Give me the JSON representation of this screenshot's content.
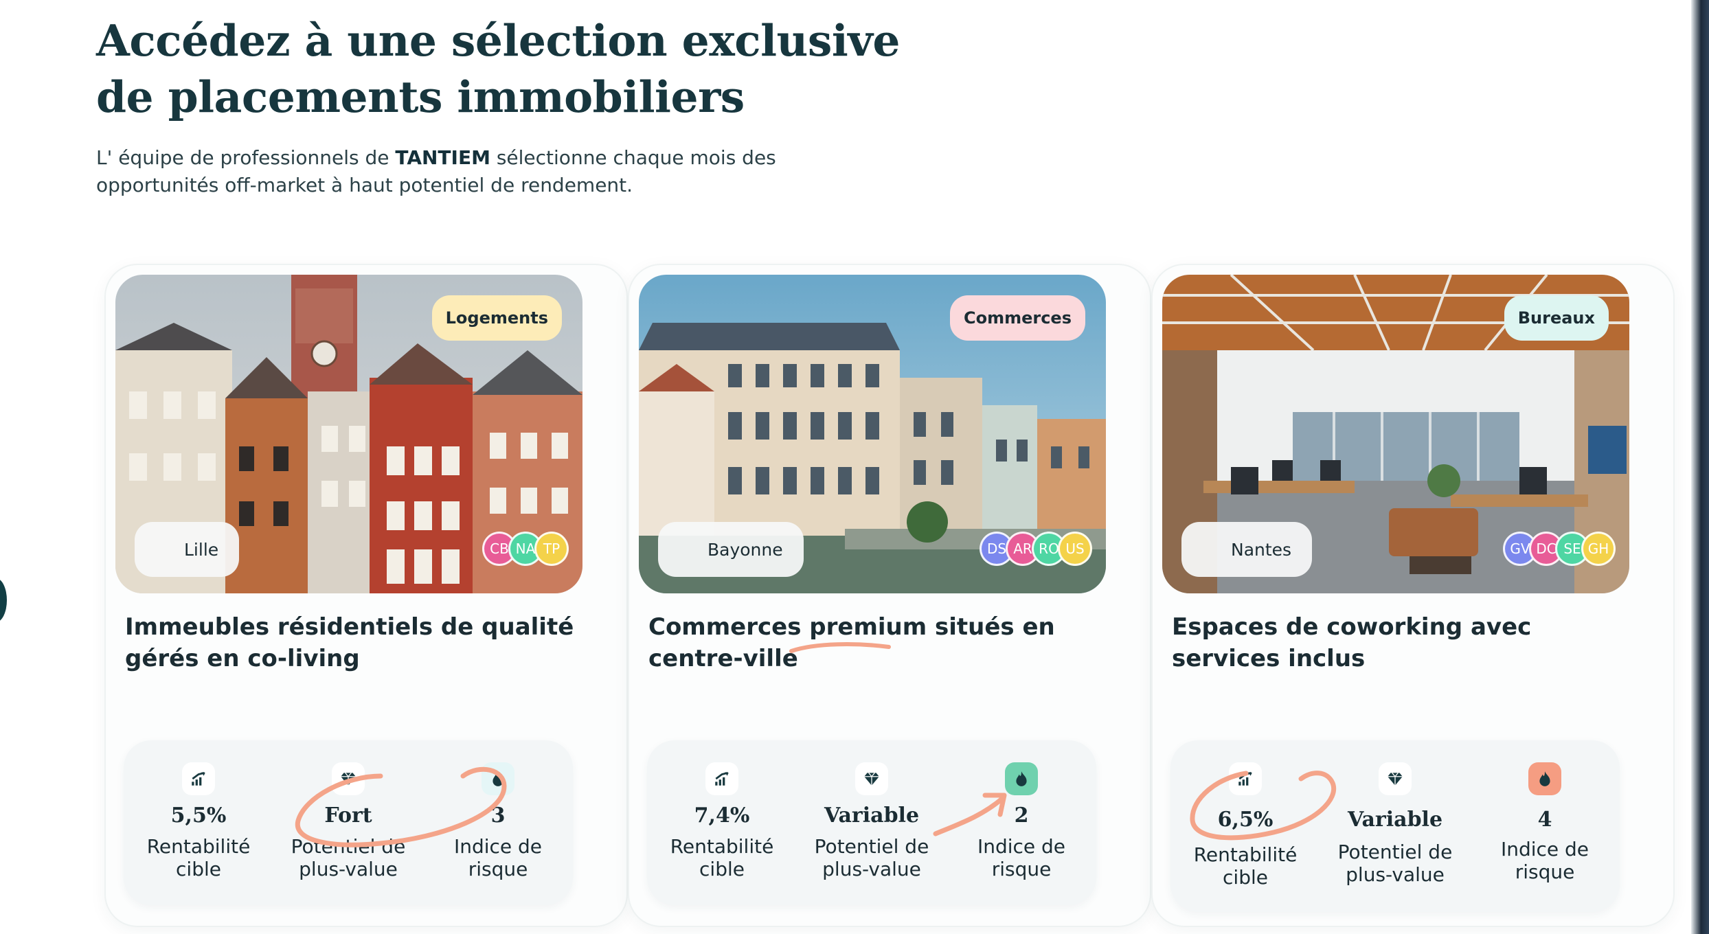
{
  "hero": {
    "title_line1": "Accédez à une sélection exclusive",
    "title_line2": "de placements immobiliers",
    "intro_before": "L' équipe de professionnels de ",
    "intro_brand": "TANTIEM",
    "intro_after": " sélectionne chaque mois des",
    "intro_line2": "opportunités off-market à haut potentiel de rendement."
  },
  "cards": [
    {
      "tag": "Logements",
      "tag_color": "#fdecb8",
      "location": "Lille",
      "avatars": [
        "CB",
        "NA",
        "TP"
      ],
      "avatar_colors": [
        "#e85c97",
        "#4ed6a3",
        "#f4d24a"
      ],
      "title": "Immeubles résidentiels de qualité gérés en co-living",
      "stats": [
        {
          "icon": "trend-up-icon",
          "value": "5,5%",
          "label_line1": "Rentabilité",
          "label_line2": "cible"
        },
        {
          "icon": "diamond-icon",
          "value": "Fort",
          "label_line1": "Potentiel de",
          "label_line2": "plus-value"
        },
        {
          "icon": "flame-icon",
          "value": "3",
          "label_line1": "Indice de",
          "label_line2": "risque"
        }
      ]
    },
    {
      "tag": "Commerces",
      "tag_color": "#fbd9dc",
      "location": "Bayonne",
      "avatars": [
        "DS",
        "AR",
        "RO",
        "US"
      ],
      "avatar_colors": [
        "#7b88ee",
        "#e85c97",
        "#4ed6a3",
        "#f4d24a"
      ],
      "title_before": "Commerces ",
      "title_highlight": "premium",
      "title_after": " situés en centre-ville",
      "stats": [
        {
          "icon": "trend-up-icon",
          "value": "7,4%",
          "label_line1": "Rentabilité",
          "label_line2": "cible"
        },
        {
          "icon": "diamond-icon",
          "value": "Variable",
          "label_line1": "Potentiel de",
          "label_line2": "plus-value"
        },
        {
          "icon": "flame-icon",
          "value": "2",
          "label_line1": "Indice de",
          "label_line2": "risque"
        }
      ]
    },
    {
      "tag": "Bureaux",
      "tag_color": "#ddf5f1",
      "location": "Nantes",
      "avatars": [
        "GV",
        "DC",
        "SE",
        "GH"
      ],
      "avatar_colors": [
        "#7b88ee",
        "#e85c97",
        "#4ed6a3",
        "#f4d24a"
      ],
      "title": "Espaces de coworking avec services inclus",
      "stats": [
        {
          "icon": "trend-up-icon",
          "value": "6,5%",
          "label_line1": "Rentabilité",
          "label_line2": "cible"
        },
        {
          "icon": "diamond-icon",
          "value": "Variable",
          "label_line1": "Potentiel de",
          "label_line2": "plus-value"
        },
        {
          "icon": "flame-icon",
          "value": "4",
          "label_line1": "Indice de",
          "label_line2": "risque"
        }
      ]
    }
  ],
  "colors": {
    "heading": "#17363e",
    "text": "#1b2c33",
    "annotation": "#f4a489",
    "risk_low": "#6fd1ae",
    "risk_high": "#f59d82"
  }
}
